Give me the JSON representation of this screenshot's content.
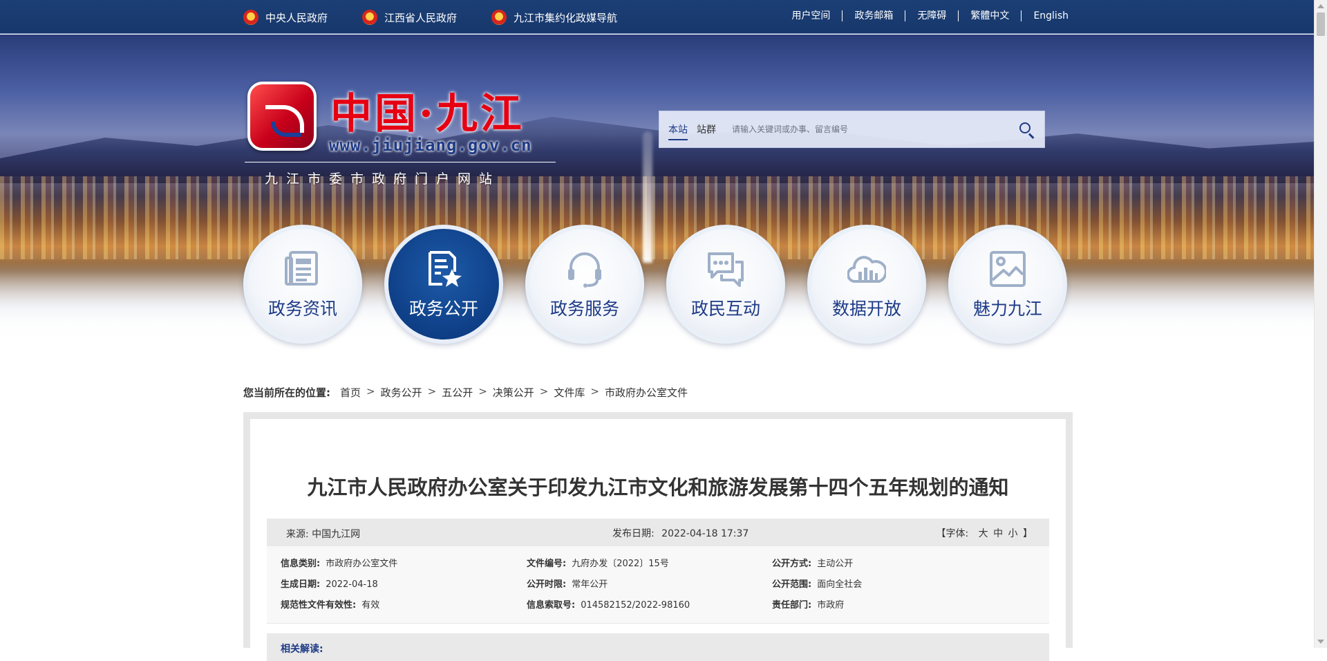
{
  "topbar": {
    "left_links": [
      {
        "label": "中央人民政府",
        "icon": "national-emblem-icon"
      },
      {
        "label": "江西省人民政府",
        "icon": "national-emblem-icon"
      },
      {
        "label": "九江市集约化政媒导航",
        "icon": "national-emblem-icon"
      }
    ],
    "right_links": [
      "用户空间",
      "政务邮箱",
      "无障碍",
      "繁體中文",
      "English"
    ]
  },
  "logo": {
    "title": "中国·九江",
    "url": "www.jiujiang.gov.cn",
    "subtitle": "九江市委市政府门户网站"
  },
  "search": {
    "tabs": [
      "本站",
      "站群"
    ],
    "active_tab": "本站",
    "placeholder": "请输入关键词或办事、留言编号",
    "value": ""
  },
  "nav": {
    "items": [
      {
        "label": "政务资讯",
        "icon": "news-document-icon",
        "active": false
      },
      {
        "label": "政务公开",
        "icon": "document-star-icon",
        "active": true
      },
      {
        "label": "政务服务",
        "icon": "headset-icon",
        "active": false
      },
      {
        "label": "政民互动",
        "icon": "chat-bubbles-icon",
        "active": false
      },
      {
        "label": "数据开放",
        "icon": "cloud-chart-icon",
        "active": false
      },
      {
        "label": "魅力九江",
        "icon": "image-gallery-icon",
        "active": false
      }
    ]
  },
  "breadcrumb": {
    "lead": "您当前所在的位置:",
    "items": [
      "首页",
      "政务公开",
      "五公开",
      "决策公开",
      "文件库",
      "市政府办公室文件"
    ],
    "separator": ">"
  },
  "article": {
    "title": "九江市人民政府办公室关于印发九江市文化和旅游发展第十四个五年规划的通知",
    "source_label": "来源:",
    "source_value": "中国九江网",
    "date_label": "发布日期:",
    "date_value": "2022-04-18 17:37",
    "fontsize": {
      "open": "【字体:",
      "large": "大",
      "medium": "中",
      "small": "小",
      "close": "】"
    },
    "info": [
      [
        {
          "k": "信息类别:",
          "v": "市政府办公室文件"
        },
        {
          "k": "文件编号:",
          "v": "九府办发〔2022〕15号"
        },
        {
          "k": "公开方式:",
          "v": "主动公开"
        }
      ],
      [
        {
          "k": "生成日期:",
          "v": "2022-04-18"
        },
        {
          "k": "公开时限:",
          "v": "常年公开"
        },
        {
          "k": "公开范围:",
          "v": "面向全社会"
        }
      ],
      [
        {
          "k": "规范性文件有效性:",
          "v": "有效"
        },
        {
          "k": "信息索取号:",
          "v": "014582152/2022-98160"
        },
        {
          "k": "责任部门:",
          "v": "市政府"
        }
      ]
    ],
    "related_label": "相关解读:"
  },
  "colors": {
    "topbar": "#17376b",
    "brand_blue": "#1d3a86",
    "brand_red": "#e60012",
    "active_nav": "#0e3f87"
  }
}
